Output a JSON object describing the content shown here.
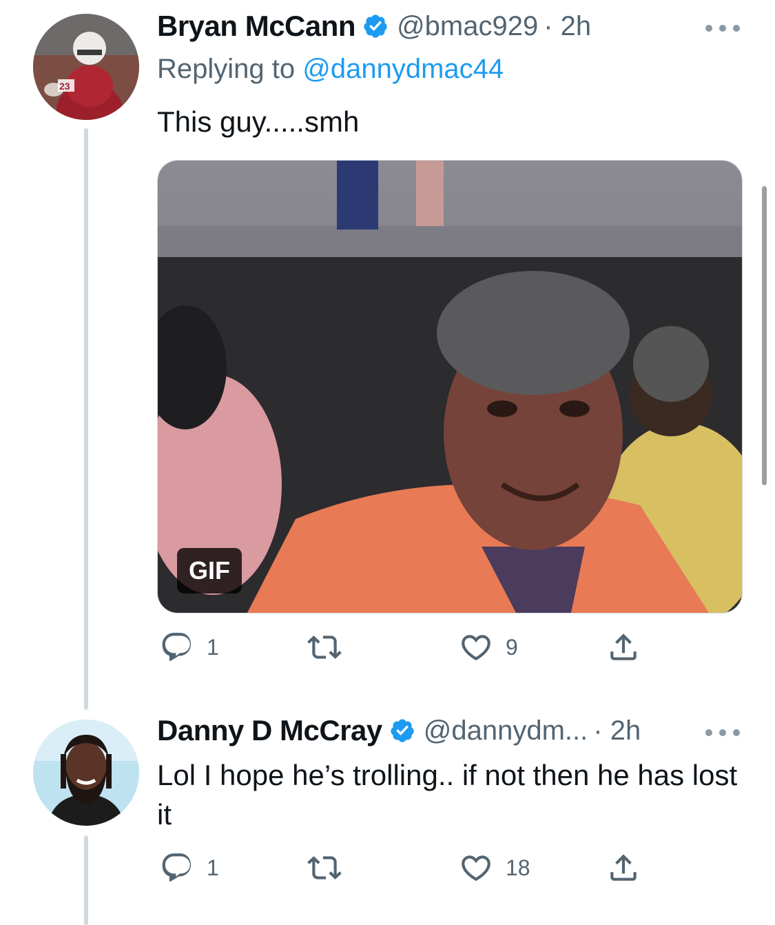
{
  "tweets": [
    {
      "name": "Bryan McCann",
      "handle": "@bmac929",
      "time": "· 2h",
      "replying_prefix": "Replying to",
      "replying_handle": "@dannydmac44",
      "text": "This guy.....smh",
      "media_badge": "GIF",
      "replies": "1",
      "likes": "9",
      "avatar_icon": "football-player-avatar"
    },
    {
      "name": "Danny D McCray",
      "handle": "@dannydm...",
      "time": "· 2h",
      "text": "Lol I hope he’s trolling.. if not then he has lost it",
      "replies": "1",
      "likes": "18",
      "avatar_icon": "bearded-man-avatar"
    }
  ],
  "colors": {
    "accent": "#1d9bf0",
    "muted": "#536471",
    "thread_line": "#cfd9de"
  }
}
